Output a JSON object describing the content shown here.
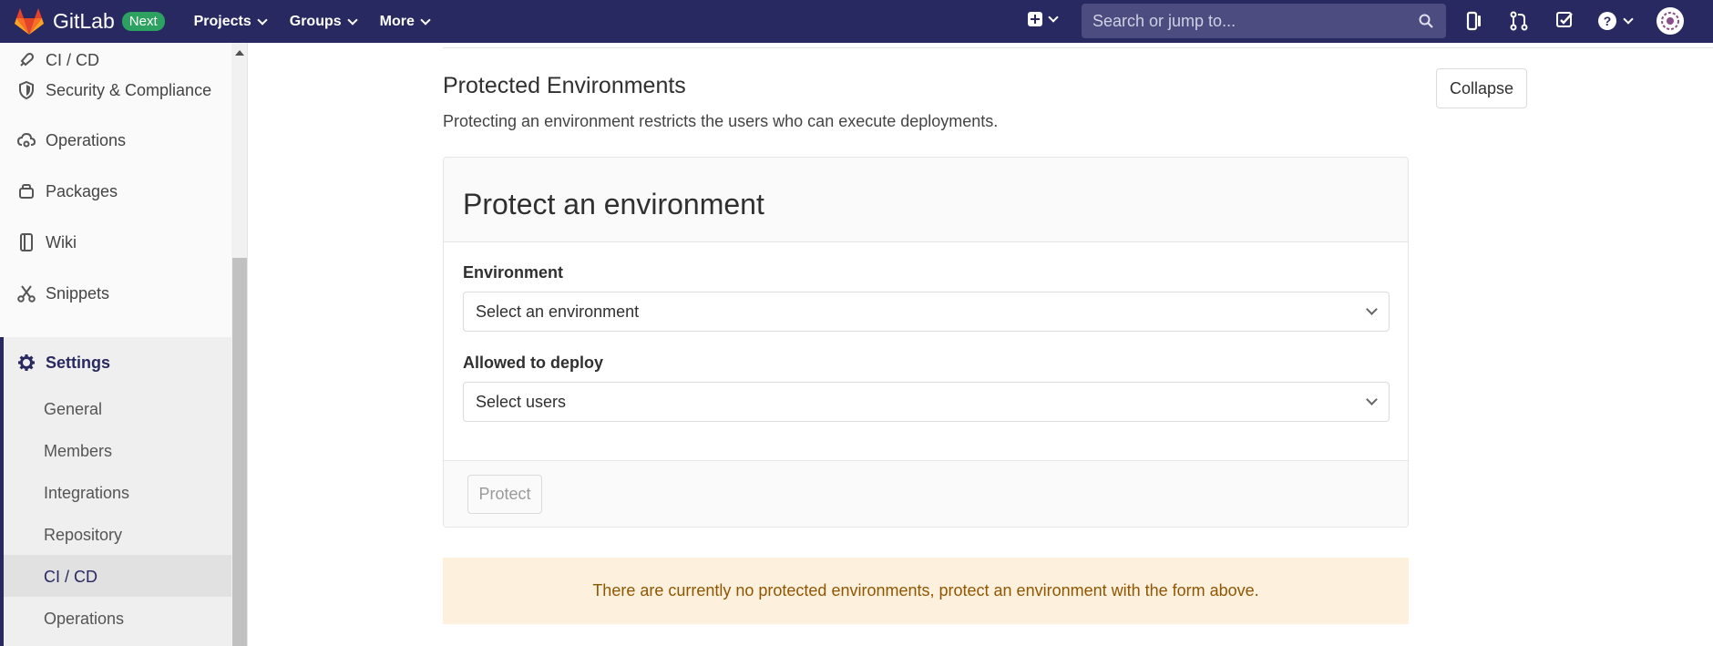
{
  "navbar": {
    "brand": "GitLab",
    "badge": "Next",
    "menu": [
      {
        "label": "Projects"
      },
      {
        "label": "Groups"
      },
      {
        "label": "More"
      }
    ],
    "search": {
      "placeholder": "Search or jump to..."
    },
    "icons": [
      "plus-square-icon",
      "search-icon",
      "issues-icon",
      "merge-request-icon",
      "todo-icon",
      "help-icon"
    ],
    "brand_color": "#292961"
  },
  "sidebar": {
    "items": [
      {
        "label": "CI / CD",
        "icon": "rocket-icon"
      },
      {
        "label": "Security & Compliance",
        "icon": "shield-icon"
      },
      {
        "label": "Operations",
        "icon": "cloud-gear-icon"
      },
      {
        "label": "Packages",
        "icon": "package-icon"
      },
      {
        "label": "Wiki",
        "icon": "book-icon"
      },
      {
        "label": "Snippets",
        "icon": "scissors-icon"
      },
      {
        "label": "Settings",
        "icon": "gear-icon"
      }
    ],
    "subitems": [
      {
        "label": "General"
      },
      {
        "label": "Members"
      },
      {
        "label": "Integrations"
      },
      {
        "label": "Repository"
      },
      {
        "label": "CI / CD"
      },
      {
        "label": "Operations"
      }
    ],
    "active_subitem": "CI / CD"
  },
  "main": {
    "section_title": "Protected Environments",
    "section_desc": "Protecting an environment restricts the users who can execute deployments.",
    "collapse_label": "Collapse",
    "card": {
      "title": "Protect an environment",
      "env_label": "Environment",
      "env_value": "Select an environment",
      "deploy_label": "Allowed to deploy",
      "deploy_value": "Select users",
      "protect_label": "Protect"
    },
    "alert": "There are currently no protected environments, protect an environment with the form above.",
    "alert_bg": "#fdf1dd",
    "alert_text_color": "#8f5502"
  }
}
